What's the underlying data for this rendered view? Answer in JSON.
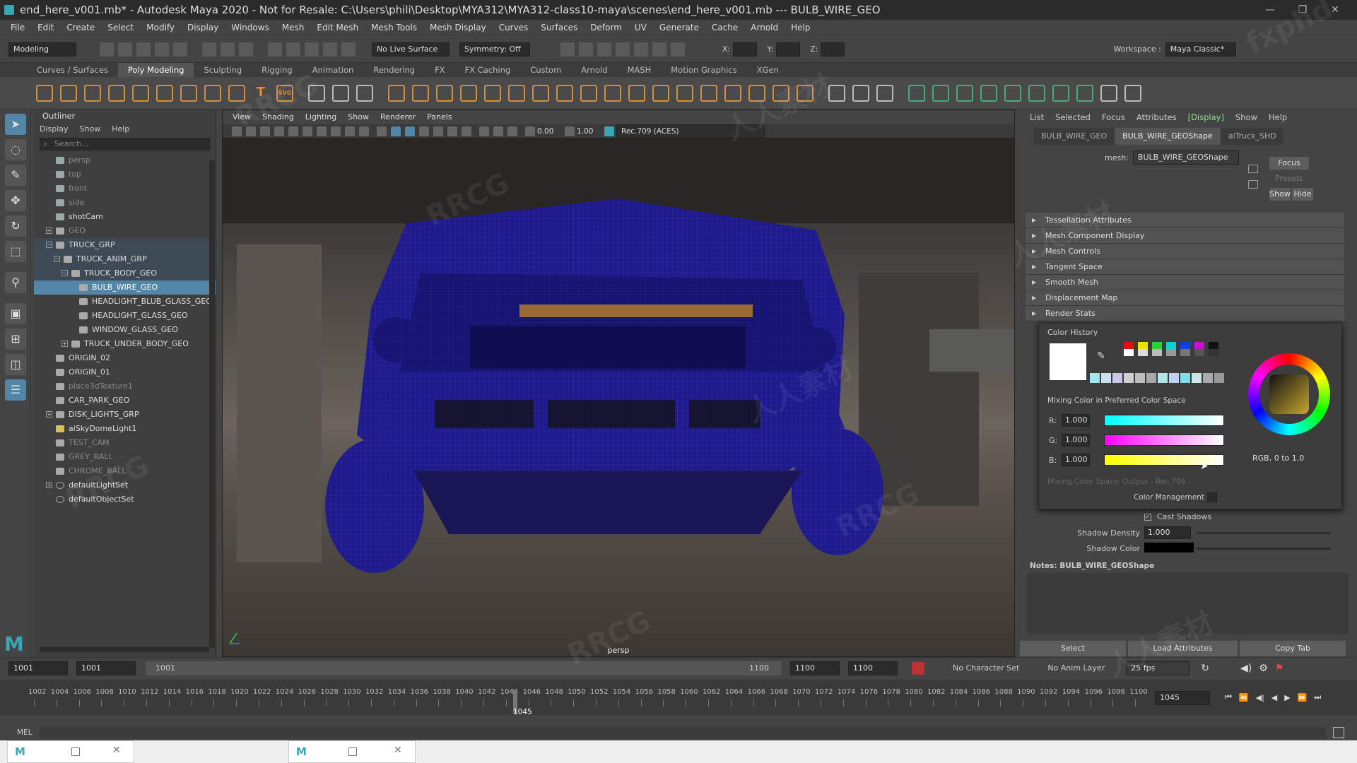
{
  "window": {
    "title": "end_here_v001.mb* - Autodesk Maya 2020 - Not for Resale: C:\\Users\\phili\\Desktop\\MYA312\\MYA312-class10-maya\\scenes\\end_here_v001.mb  ---  BULB_WIRE_GEO",
    "minimize": "—",
    "restore": "❐",
    "close": "✕"
  },
  "menus": [
    "File",
    "Edit",
    "Create",
    "Select",
    "Modify",
    "Display",
    "Windows",
    "Mesh",
    "Edit Mesh",
    "Mesh Tools",
    "Mesh Display",
    "Curves",
    "Surfaces",
    "Deform",
    "UV",
    "Generate",
    "Cache",
    "Arnold",
    "Help"
  ],
  "status": {
    "menuset": "Modeling",
    "live_surface": "No Live Surface",
    "symmetry": "Symmetry: Off",
    "x": "X:",
    "y": "Y:",
    "z": "Z:",
    "workspace_label": "Workspace :",
    "workspace": "Maya Classic*"
  },
  "shelf_tabs": [
    "Curves / Surfaces",
    "Poly Modeling",
    "Sculpting",
    "Rigging",
    "Animation",
    "Rendering",
    "FX",
    "FX Caching",
    "Custom",
    "Arnold",
    "MASH",
    "Motion Graphics",
    "XGen"
  ],
  "shelf_text_icons": {
    "text": "T",
    "svg": "SVG"
  },
  "outliner": {
    "title": "Outliner",
    "menu": [
      "Display",
      "Show",
      "Help"
    ],
    "search_placeholder": "Search...",
    "items": [
      {
        "label": "persp",
        "dim": true
      },
      {
        "label": "top",
        "dim": true
      },
      {
        "label": "front",
        "dim": true
      },
      {
        "label": "side",
        "dim": true
      },
      {
        "label": "shotCam"
      },
      {
        "label": "GEO",
        "dim": true
      },
      {
        "label": "TRUCK_GRP"
      },
      {
        "label": "TRUCK_ANIM_GRP"
      },
      {
        "label": "TRUCK_BODY_GEO"
      },
      {
        "label": "BULB_WIRE_GEO"
      },
      {
        "label": "HEADLIGHT_BLUB_GLASS_GEO"
      },
      {
        "label": "HEADLIGHT_GLASS_GEO"
      },
      {
        "label": "WINDOW_GLASS_GEO"
      },
      {
        "label": "TRUCK_UNDER_BODY_GEO"
      },
      {
        "label": "ORIGIN_02"
      },
      {
        "label": "ORIGIN_01"
      },
      {
        "label": "place3dTexture1",
        "dim": true
      },
      {
        "label": "CAR_PARK_GEO"
      },
      {
        "label": "DISK_LIGHTS_GRP"
      },
      {
        "label": "aiSkyDomeLight1"
      },
      {
        "label": "TEST_CAM",
        "dim": true
      },
      {
        "label": "GREY_BALL",
        "dim": true
      },
      {
        "label": "CHROME_BALL",
        "dim": true
      },
      {
        "label": "defaultLightSet"
      },
      {
        "label": "defaultObjectSet"
      }
    ]
  },
  "viewport": {
    "menu": [
      "View",
      "Shading",
      "Lighting",
      "Show",
      "Renderer",
      "Panels"
    ],
    "exposure": "0.00",
    "gamma": "1.00",
    "colorspace": "Rec.709 (ACES)",
    "camera_label": "persp"
  },
  "attr": {
    "menu": [
      "List",
      "Selected",
      "Focus",
      "Attributes",
      "[Display]",
      "Show",
      "Help"
    ],
    "tabs": [
      "BULB_WIRE_GEO",
      "BULB_WIRE_GEOShape",
      "aiTruck_SHD"
    ],
    "mesh_label": "mesh:",
    "mesh_value": "BULB_WIRE_GEOShape",
    "focus": "Focus",
    "presets": "Presets",
    "show": "Show",
    "hide": "Hide",
    "sections": [
      "Tessellation Attributes",
      "Mesh Component Display",
      "Mesh Controls",
      "Tangent Space",
      "Smooth Mesh",
      "Displacement Map",
      "Render Stats"
    ],
    "cast_shadows": "Cast Shadows",
    "shadow_density_label": "Shadow Density",
    "shadow_density": "1.000",
    "shadow_color_label": "Shadow Color",
    "notes": "Notes:  BULB_WIRE_GEOShape",
    "btn_select": "Select",
    "btn_load": "Load Attributes",
    "btn_copy": "Copy Tab"
  },
  "color_editor": {
    "title": "Color History",
    "mixing_label": "Mixing Color in Preferred Color Space",
    "r_label": "R:",
    "r": "1.000",
    "g_label": "G:",
    "g": "1.000",
    "b_label": "B:",
    "b": "1.000",
    "mixing_space_label": "Mixing Color Space:",
    "mixing_space": "Output - Rec.709",
    "color_mgmt": "Color Management",
    "range": "RGB, 0 to 1.0"
  },
  "time": {
    "start": "1001",
    "anim_start": "1001",
    "range_start": "1001",
    "range_end": "1100",
    "anim_end": "1100",
    "end": "1100",
    "character": "No Character Set",
    "anim_layer": "No Anim Layer",
    "fps": "25 fps",
    "current": "1045",
    "current_field": "1045",
    "ticks": [
      "1002",
      "1004",
      "1006",
      "1008",
      "1010",
      "1012",
      "1014",
      "1016",
      "1018",
      "1020",
      "1022",
      "1024",
      "1026",
      "1028",
      "1030",
      "1032",
      "1034",
      "1036",
      "1038",
      "1040",
      "1042",
      "1044",
      "1046",
      "1048",
      "1050",
      "1052",
      "1054",
      "1056",
      "1058",
      "1060",
      "1062",
      "1064",
      "1066",
      "1068",
      "1070",
      "1072",
      "1074",
      "1076",
      "1078",
      "1080",
      "1082",
      "1084",
      "1086",
      "1088",
      "1090",
      "1092",
      "1094",
      "1096",
      "1098",
      "1100"
    ]
  },
  "cmd": {
    "label": "MEL"
  },
  "taskbar": {
    "app": "M"
  },
  "watermarks": [
    "RRCG",
    "人人素材",
    "RRCG",
    "人人素材",
    "RRCG",
    "人人素材",
    "RRCG",
    "RRCG",
    "人人素材",
    "fxphd"
  ],
  "colors": {
    "selection": "#5285a6",
    "wire": "#1e1a8a"
  }
}
